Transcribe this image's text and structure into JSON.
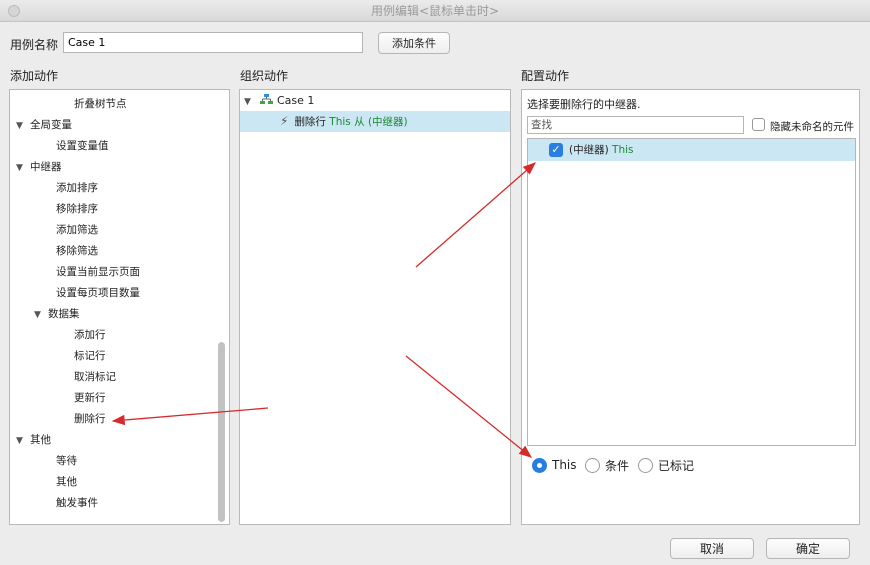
{
  "window": {
    "title": "用例编辑<鼠标单击时>"
  },
  "case_name": {
    "label": "用例名称",
    "value": "Case 1"
  },
  "buttons": {
    "add_condition": "添加条件",
    "cancel": "取消",
    "ok": "确定"
  },
  "sections": {
    "add_action": "添加动作",
    "organize_action": "组织动作",
    "configure_action": "配置动作"
  },
  "action_tree": [
    {
      "label": "折叠树节点",
      "level": 2,
      "expandable": false
    },
    {
      "label": "全局变量",
      "level": 0,
      "expandable": true
    },
    {
      "label": "设置变量值",
      "level": 1,
      "expandable": false
    },
    {
      "label": "中继器",
      "level": 0,
      "expandable": true
    },
    {
      "label": "添加排序",
      "level": 1,
      "expandable": false
    },
    {
      "label": "移除排序",
      "level": 1,
      "expandable": false
    },
    {
      "label": "添加筛选",
      "level": 1,
      "expandable": false
    },
    {
      "label": "移除筛选",
      "level": 1,
      "expandable": false
    },
    {
      "label": "设置当前显示页面",
      "level": 1,
      "expandable": false
    },
    {
      "label": "设置每页项目数量",
      "level": 1,
      "expandable": false
    },
    {
      "label": "数据集",
      "level": 1,
      "expandable": true
    },
    {
      "label": "添加行",
      "level": 2,
      "expandable": false
    },
    {
      "label": "标记行",
      "level": 2,
      "expandable": false
    },
    {
      "label": "取消标记",
      "level": 2,
      "expandable": false
    },
    {
      "label": "更新行",
      "level": 2,
      "expandable": false
    },
    {
      "label": "删除行",
      "level": 2,
      "expandable": false
    },
    {
      "label": "其他",
      "level": 0,
      "expandable": true
    },
    {
      "label": "等待",
      "level": 1,
      "expandable": false
    },
    {
      "label": "其他",
      "level": 1,
      "expandable": false
    },
    {
      "label": "触发事件",
      "level": 1,
      "expandable": false
    }
  ],
  "organize": {
    "case_label": "Case 1",
    "action": {
      "prefix": "删除行",
      "target": "This",
      "from": "从",
      "type": "(中继器)"
    }
  },
  "configure": {
    "prompt": "选择要删除行的中继器.",
    "search_placeholder": "查找",
    "hide_unnamed_label": "隐藏未命名的元件",
    "repeater": {
      "type": "(中继器)",
      "name": "This",
      "checked": true
    },
    "radios": [
      {
        "label": "This",
        "selected": true
      },
      {
        "label": "条件",
        "selected": false
      },
      {
        "label": "已标记",
        "selected": false
      }
    ]
  },
  "colors": {
    "selection": "#cce7f4",
    "accent": "#2a7de1",
    "target_text": "#1a8a2e",
    "annotation": "#d62b2b"
  },
  "icons": {
    "expand": "triangle-down-icon",
    "case": "case-flow-icon",
    "action": "lightning-icon",
    "check": "checkmark-icon"
  }
}
